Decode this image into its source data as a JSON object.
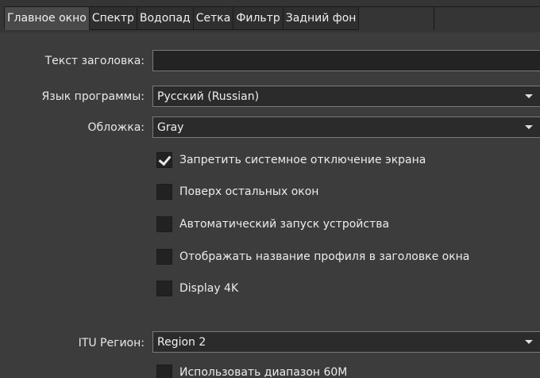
{
  "tabs": [
    {
      "label": "Главное окно",
      "active": true
    },
    {
      "label": "Спектр",
      "active": false
    },
    {
      "label": "Водопад",
      "active": false
    },
    {
      "label": "Сетка",
      "active": false
    },
    {
      "label": "Фильтр",
      "active": false
    },
    {
      "label": "Задний фон",
      "active": false
    }
  ],
  "form": {
    "title_label": "Текст заголовка:",
    "title_value": "",
    "language_label": "Язык программы:",
    "language_value": "Русский (Russian)",
    "skin_label": "Обложка:",
    "skin_value": "Gray",
    "itu_label": "ITU Регион:",
    "itu_value": "Region 2"
  },
  "checkboxes": [
    {
      "label": "Запретить системное отключение экрана",
      "checked": true
    },
    {
      "label": "Поверх остальных окон",
      "checked": false
    },
    {
      "label": "Автоматический запуск устройства",
      "checked": false
    },
    {
      "label": "Отображать название профиля в заголовке окна",
      "checked": false
    },
    {
      "label": "Display 4K",
      "checked": false
    },
    {
      "label": "Использовать диапазон 60М",
      "checked": false
    }
  ],
  "colors": {
    "background": "#3c3c3c",
    "field_background": "#2b2b2b",
    "field_border": "#7a7a7a",
    "text": "#e6e6e6"
  }
}
